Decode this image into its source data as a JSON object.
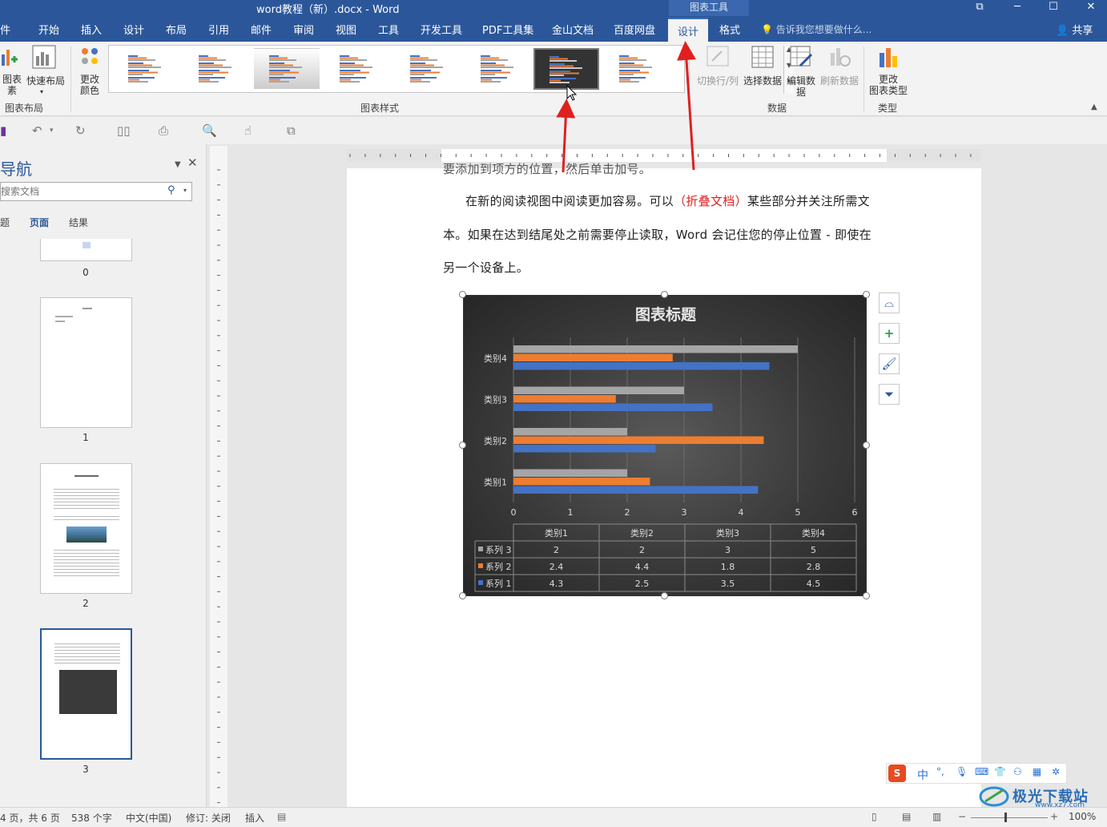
{
  "window": {
    "title": "word教程（新）.docx - Word",
    "context_tab_group": "图表工具",
    "controls": [
      "restore-icon",
      "minimize-icon",
      "maximize-icon",
      "close-icon"
    ]
  },
  "tabs": [
    {
      "label": "件"
    },
    {
      "label": "开始"
    },
    {
      "label": "插入"
    },
    {
      "label": "设计"
    },
    {
      "label": "布局"
    },
    {
      "label": "引用"
    },
    {
      "label": "邮件"
    },
    {
      "label": "审阅"
    },
    {
      "label": "视图"
    },
    {
      "label": "工具"
    },
    {
      "label": "开发工具"
    },
    {
      "label": "PDF工具集"
    },
    {
      "label": "金山文档"
    },
    {
      "label": "百度网盘"
    },
    {
      "label": "设计",
      "active": true
    },
    {
      "label": "格式"
    }
  ],
  "tell_me": "告诉我您想要做什么...",
  "share": "共享",
  "ribbon": {
    "add_element_label": "图表\n素",
    "quick_layout_label": "快速布局",
    "layout_group": "图表布局",
    "change_color_label": "更改\n颜色",
    "styles_group": "图表样式",
    "switch_row_col": "切换行/列",
    "select_data": "选择数据",
    "edit_data": "编辑数\n据",
    "refresh_data": "刷新数据",
    "data_group": "数据",
    "change_type": "更改\n图表类型",
    "type_group": "类型"
  },
  "nav": {
    "title": "导航",
    "search_placeholder": "搜索文档",
    "tabs": [
      "题",
      "页面",
      "结果"
    ],
    "pages": [
      "0",
      "1",
      "2",
      "3"
    ]
  },
  "document": {
    "line0": "要添加到项方的位置，然后单击加号。",
    "line1_a": "在新的阅读视图中阅读更加容易。可以",
    "line1_red": "（折叠文档）",
    "line1_b": "某些部分并关注所需文",
    "line2": "本。如果在达到结尾处之前需要停止读取，Word 会记住您的停止位置 - 即使在",
    "line3": "另一个设备上。"
  },
  "chart_data": {
    "type": "bar",
    "orientation": "horizontal",
    "title": "图表标题",
    "categories": [
      "类别1",
      "类别2",
      "类别3",
      "类别4"
    ],
    "series": [
      {
        "name": "系列 1",
        "values": [
          4.3,
          2.5,
          3.5,
          4.5
        ],
        "color": "#4472c4"
      },
      {
        "name": "系列 2",
        "values": [
          2.4,
          4.4,
          1.8,
          2.8
        ],
        "color": "#ed7d31"
      },
      {
        "name": "系列 3",
        "values": [
          2,
          2,
          3,
          5
        ],
        "color": "#a5a5a5"
      }
    ],
    "xlim": [
      0,
      6
    ],
    "ticks": [
      "0",
      "1",
      "2",
      "3",
      "4",
      "5",
      "6"
    ],
    "grid": true,
    "data_table": true,
    "background": "#3a3a3a"
  },
  "status": {
    "pages": "4 页，共 6 页",
    "words": "538 个字",
    "language": "中文(中国)",
    "track": "修订: 关闭",
    "mode": "插入",
    "zoom": "100%"
  },
  "ime": {
    "lang": "中"
  },
  "watermark": "极光下载站",
  "watermark_url": "www.xz7.com"
}
